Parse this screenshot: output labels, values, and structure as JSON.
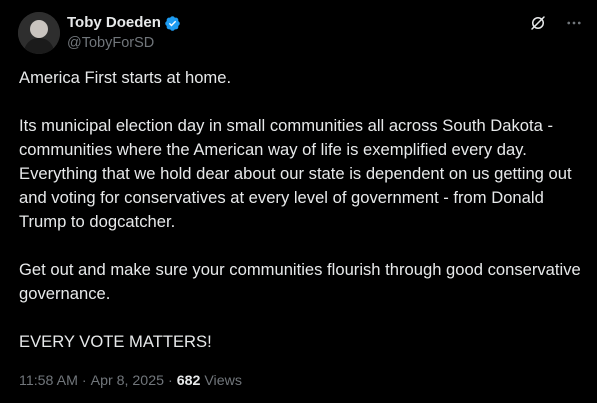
{
  "author": {
    "display_name": "Toby Doeden",
    "handle": "@TobyForSD",
    "verified": true
  },
  "icons": {
    "verified": "verified-badge-icon",
    "grok": "grok-icon",
    "more": "more-options-icon"
  },
  "colors": {
    "background": "#000000",
    "text": "#e7e9ea",
    "muted": "#71767b",
    "verified": "#1d9bf0"
  },
  "tweet": {
    "paragraphs": [
      "America First starts at home.",
      "Its municipal election day in small communities all across South Dakota - communities where the American way of life is exemplified every day. Everything that we hold dear about our state is dependent on us getting out and voting for conservatives at every level of government - from Donald Trump to dogcatcher.",
      "Get out and make sure your communities flourish through good conservative governance.",
      "EVERY VOTE MATTERS!"
    ]
  },
  "meta": {
    "time": "11:58 AM",
    "separator": "·",
    "date": "Apr 8, 2025",
    "views_count": "682",
    "views_label": "Views"
  }
}
